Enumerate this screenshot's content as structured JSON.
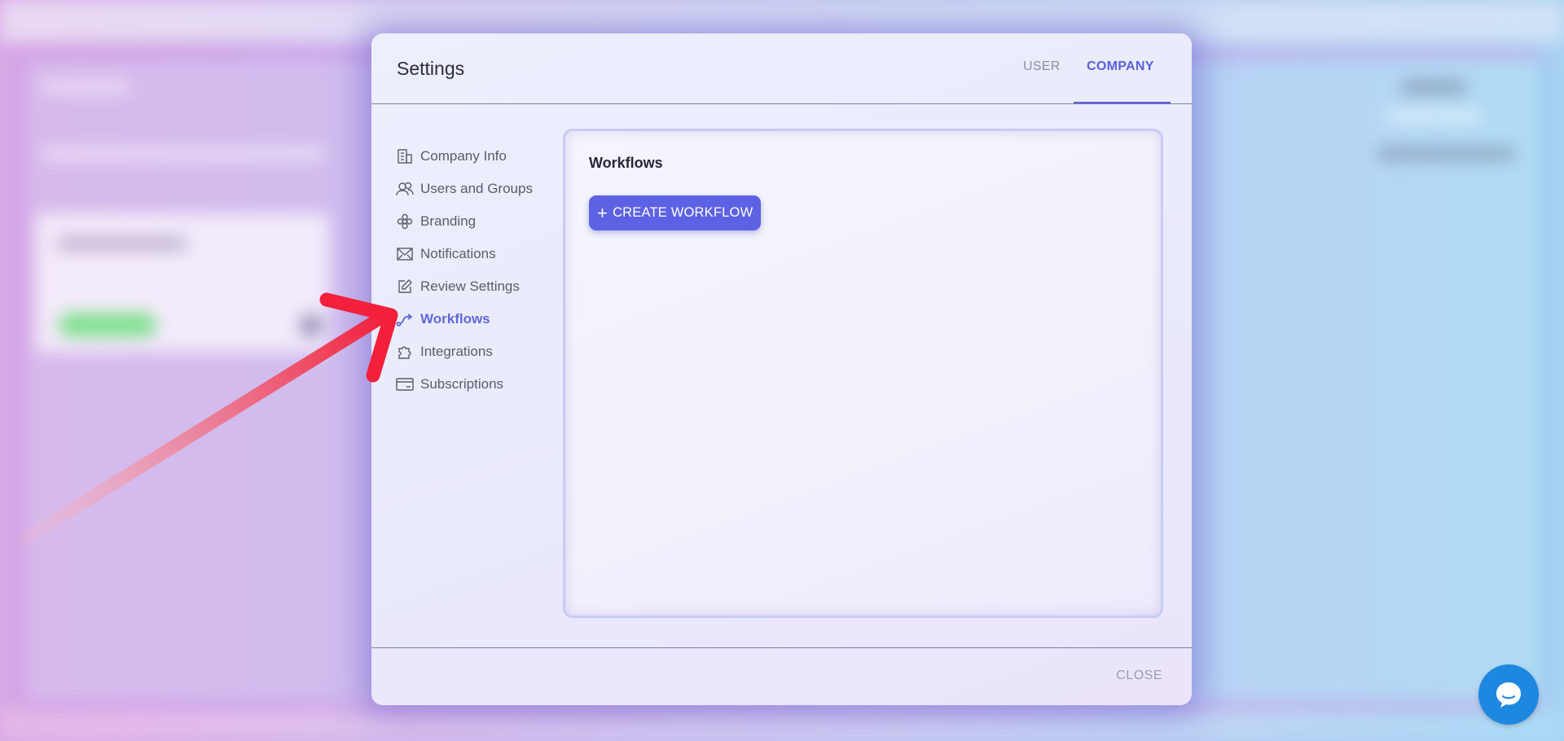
{
  "modal": {
    "title": "Settings",
    "tabs": [
      {
        "label": "USER",
        "active": false
      },
      {
        "label": "COMPANY",
        "active": true
      }
    ],
    "close_label": "CLOSE"
  },
  "sidebar": {
    "items": [
      {
        "label": "Company Info",
        "icon": "building-icon"
      },
      {
        "label": "Users and Groups",
        "icon": "users-icon"
      },
      {
        "label": "Branding",
        "icon": "flower-icon"
      },
      {
        "label": "Notifications",
        "icon": "envelope-icon"
      },
      {
        "label": "Review Settings",
        "icon": "edit-icon"
      },
      {
        "label": "Workflows",
        "icon": "workflow-route-icon",
        "active": true
      },
      {
        "label": "Integrations",
        "icon": "puzzle-icon"
      },
      {
        "label": "Subscriptions",
        "icon": "card-icon"
      }
    ]
  },
  "content": {
    "title": "Workflows",
    "create_button_label": "CREATE WORKFLOW"
  },
  "colors": {
    "accent": "#5d61e3",
    "active_text": "#6267d9",
    "annotation_arrow": "#f2203a",
    "chat_button": "#1e88e0"
  }
}
